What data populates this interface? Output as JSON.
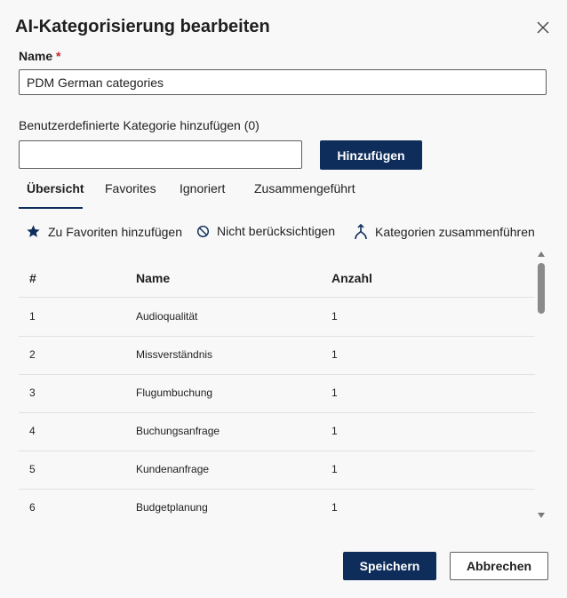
{
  "dialog": {
    "title": "AI-Kategorisierung bearbeiten",
    "close_icon": "close-icon"
  },
  "name_field": {
    "label": "Name",
    "required_mark": "*",
    "value": "PDM German categories"
  },
  "custom_category": {
    "label": "Benutzerdefinierte Kategorie hinzufügen (0)",
    "value": "",
    "add_button": "Hinzufügen"
  },
  "tabs": [
    {
      "label": "Übersicht",
      "active": true
    },
    {
      "label": "Favorites",
      "active": false
    },
    {
      "label": "Ignoriert",
      "active": false
    },
    {
      "label": "Zusammengeführt",
      "active": false
    }
  ],
  "toolbar": [
    {
      "label": "Zu Favoriten hinzufügen",
      "icon": "star-icon"
    },
    {
      "label": "Nicht berücksichtigen",
      "icon": "block-icon"
    },
    {
      "label": "Kategorien zusammenführen",
      "icon": "merge-icon"
    }
  ],
  "table": {
    "headers": [
      "#",
      "Name",
      "Anzahl"
    ],
    "rows": [
      [
        "1",
        "Audioqualität",
        "1"
      ],
      [
        "2",
        "Missverständnis",
        "1"
      ],
      [
        "3",
        "Flugumbuchung",
        "1"
      ],
      [
        "4",
        "Buchungsanfrage",
        "1"
      ],
      [
        "5",
        "Kundenanfrage",
        "1"
      ],
      [
        "6",
        "Budgetplanung",
        "1"
      ]
    ]
  },
  "footer": {
    "save": "Speichern",
    "cancel": "Abbrechen"
  },
  "colors": {
    "primary": "#0e2d5a",
    "required": "#c4262e",
    "background": "#f8f8f8"
  }
}
